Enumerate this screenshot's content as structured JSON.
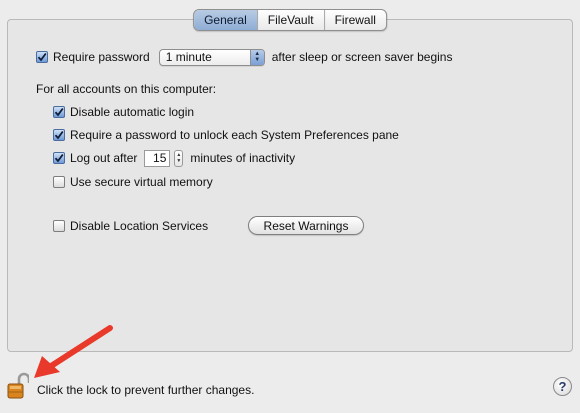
{
  "tabs": [
    {
      "label": "General",
      "active": true
    },
    {
      "label": "FileVault",
      "active": false
    },
    {
      "label": "Firewall",
      "active": false
    }
  ],
  "require_password": {
    "checked": true,
    "label": "Require password",
    "select_value": "1 minute",
    "suffix": "after sleep or screen saver begins"
  },
  "all_accounts_label": "For all accounts on this computer:",
  "options": {
    "disable_auto_login": {
      "checked": true,
      "label": "Disable automatic login"
    },
    "require_pw_prefs": {
      "checked": true,
      "label": "Require a password to unlock each System Preferences pane"
    },
    "log_out": {
      "checked": true,
      "label": "Log out after",
      "minutes": "15",
      "suffix": "minutes of inactivity"
    },
    "secure_vm": {
      "checked": false,
      "label": "Use secure virtual memory"
    },
    "disable_location": {
      "checked": false,
      "label": "Disable Location Services"
    }
  },
  "reset_warnings_label": "Reset Warnings",
  "footer": {
    "lock_text": "Click the lock to prevent further changes.",
    "help_label": "?"
  },
  "colors": {
    "accent": "#8fadd5",
    "arrow": "#e8392b",
    "lock": "#d9851f"
  }
}
